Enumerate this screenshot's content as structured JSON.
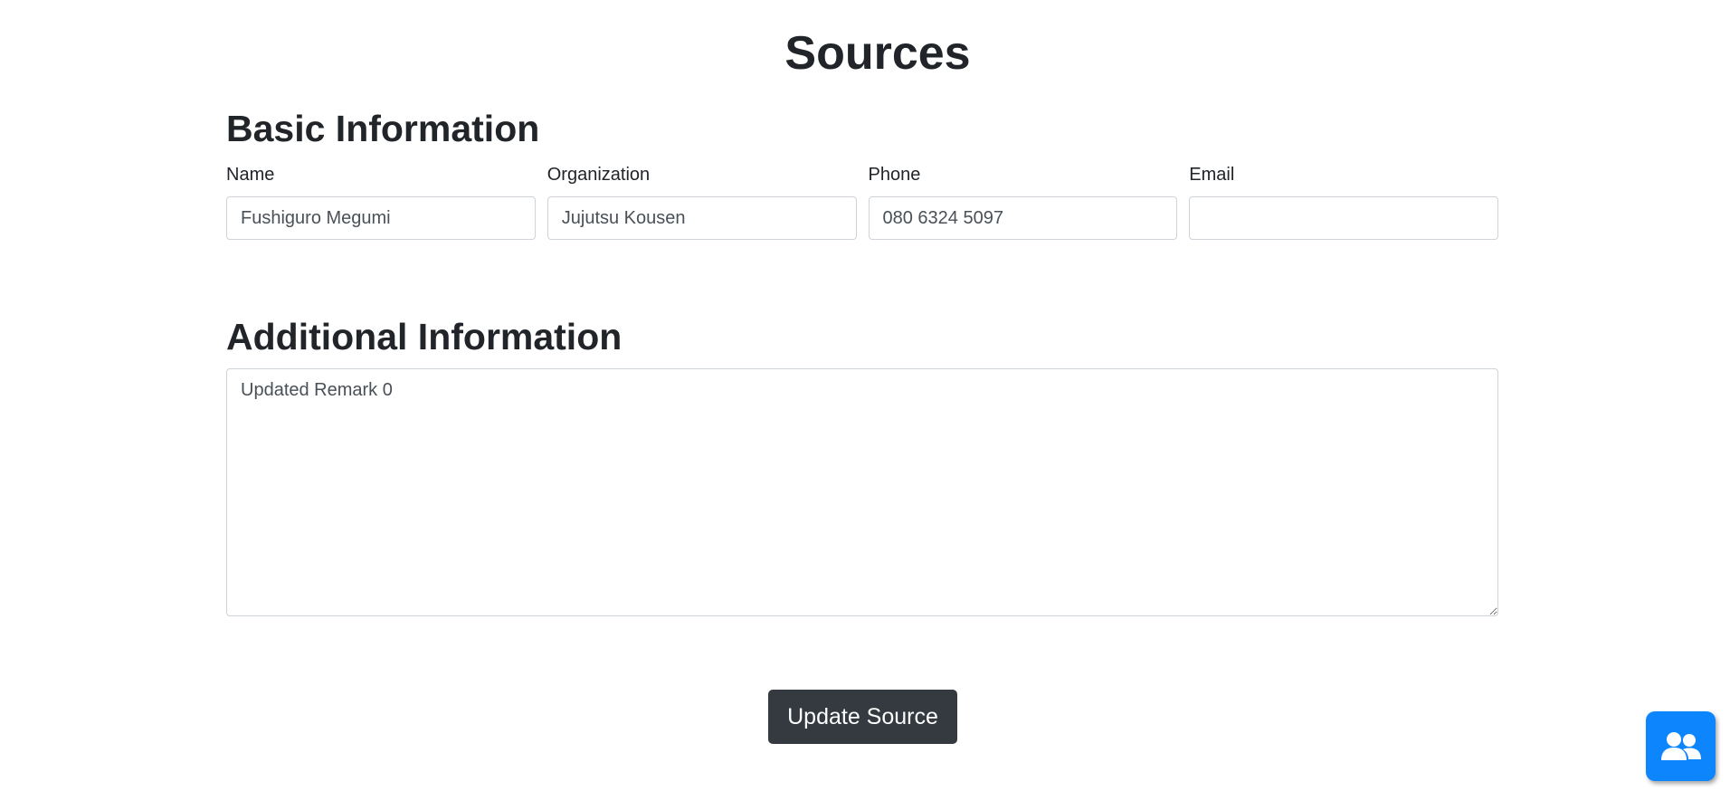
{
  "page": {
    "title": "Sources"
  },
  "basic_information": {
    "heading": "Basic Information",
    "fields": [
      {
        "label": "Name",
        "value": "Fushiguro Megumi",
        "placeholder": ""
      },
      {
        "label": "Organization",
        "value": "Jujutsu Kousen",
        "placeholder": ""
      },
      {
        "label": "Phone",
        "value": "080 6324 5097",
        "placeholder": ""
      },
      {
        "label": "Email",
        "value": "",
        "placeholder": ""
      }
    ]
  },
  "additional_information": {
    "heading": "Additional Information",
    "remarks_value": "Updated Remark 0"
  },
  "actions": {
    "submit_label": "Update Source"
  },
  "fab": {
    "icon": "users-icon",
    "color": "#0d85fd"
  }
}
